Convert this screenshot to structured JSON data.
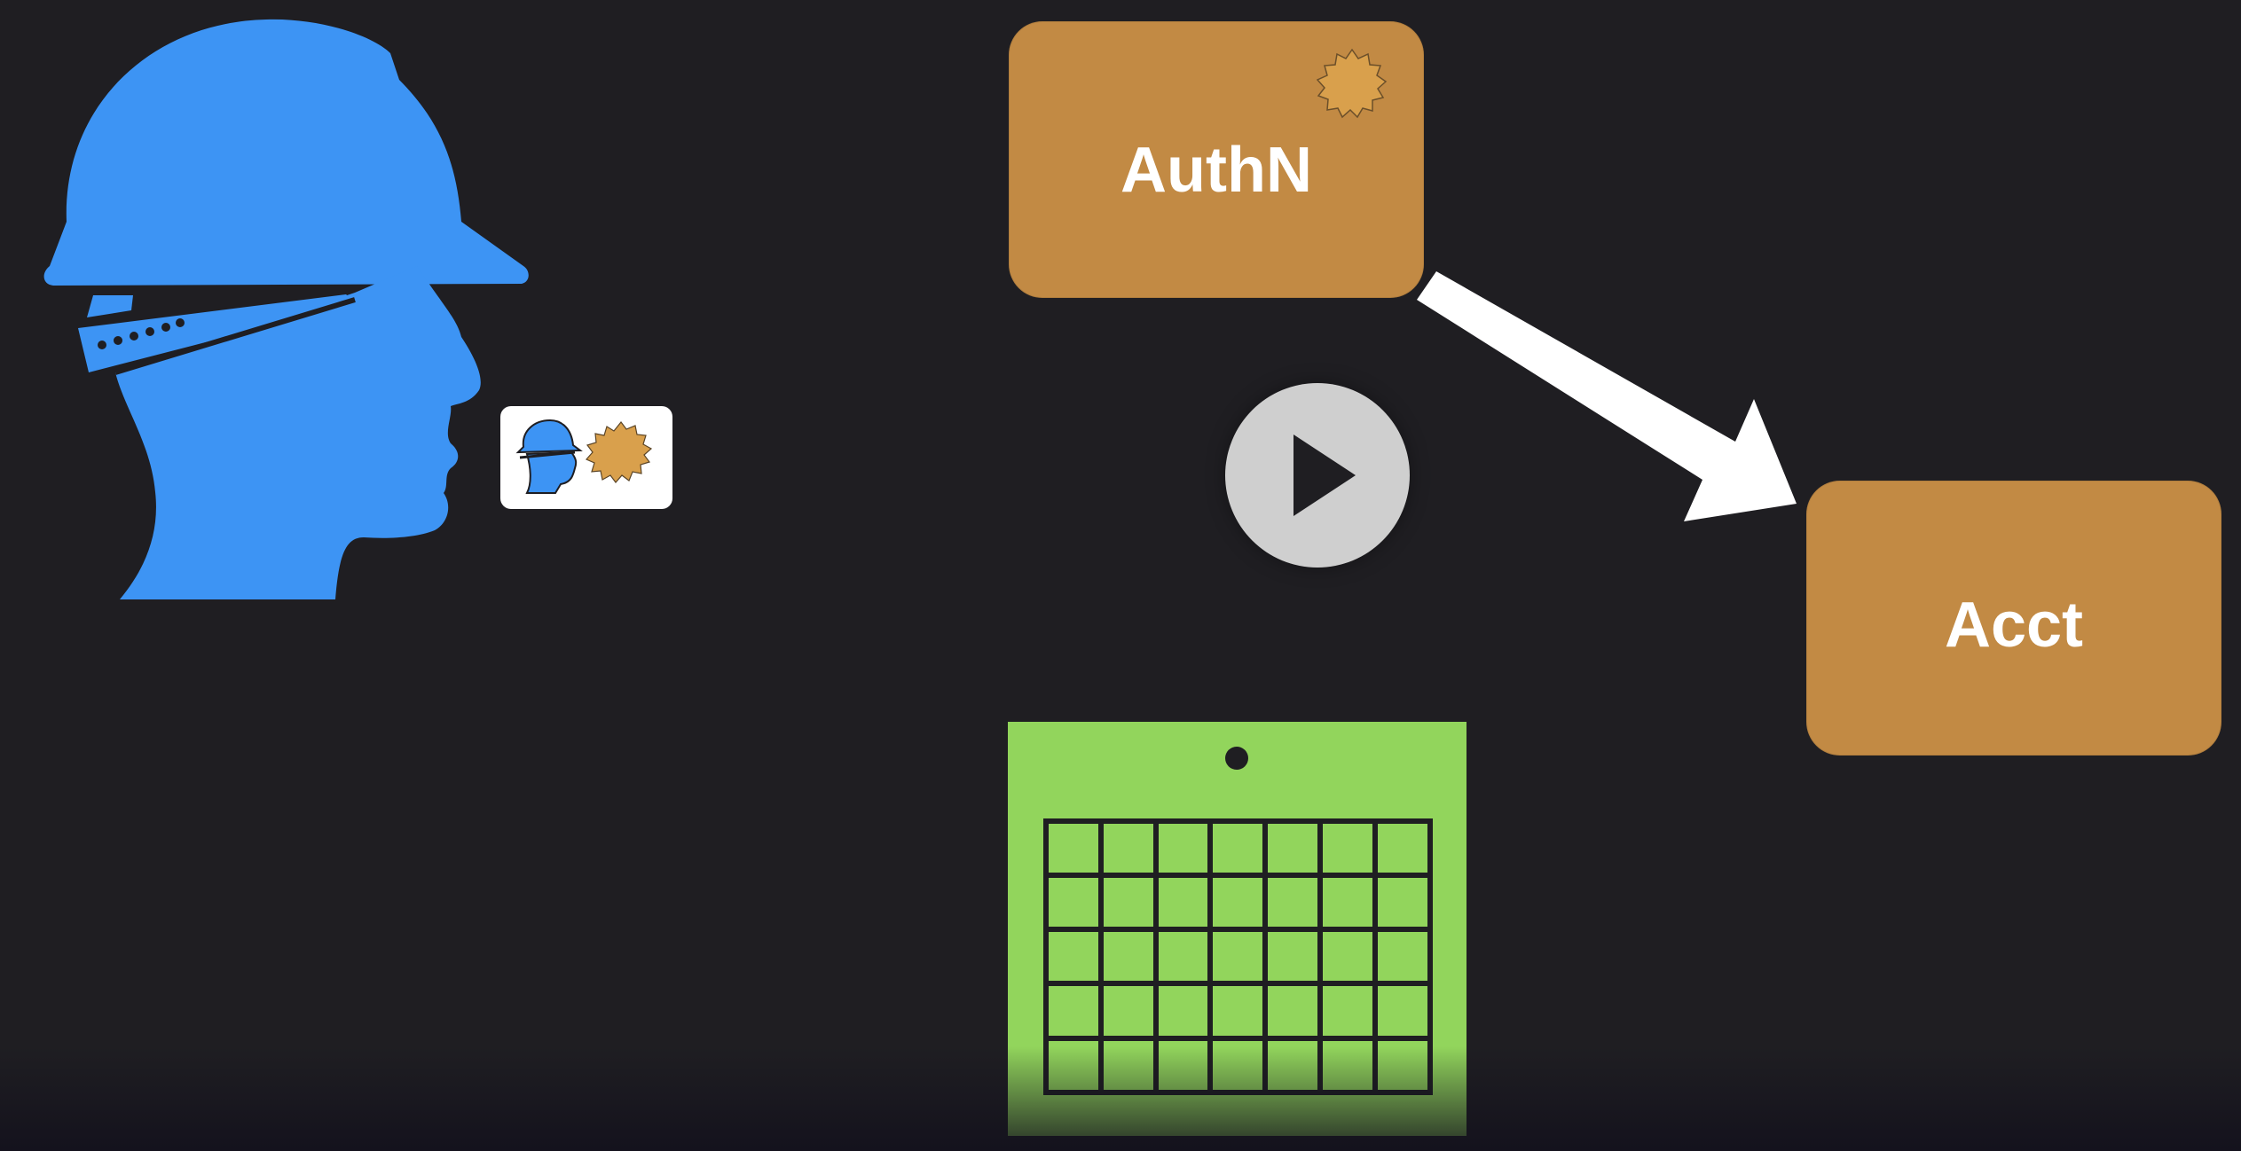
{
  "services": {
    "authn": {
      "label": "AuthN"
    },
    "acct": {
      "label": "Acct"
    }
  },
  "colors": {
    "background": "#1f1e22",
    "person_blue": "#3d94f4",
    "service_brown": "#c28a44",
    "badge_gold": "#d9a04c",
    "calendar_green": "#92d55c",
    "arrow_white": "#ffffff"
  },
  "icons": {
    "person": "hardhat-head-icon",
    "badge": "seal-badge-icon",
    "play": "play-icon",
    "calendar": "calendar-icon",
    "arrow": "arrow-icon"
  },
  "calendar": {
    "rows": 5,
    "columns": 7
  }
}
